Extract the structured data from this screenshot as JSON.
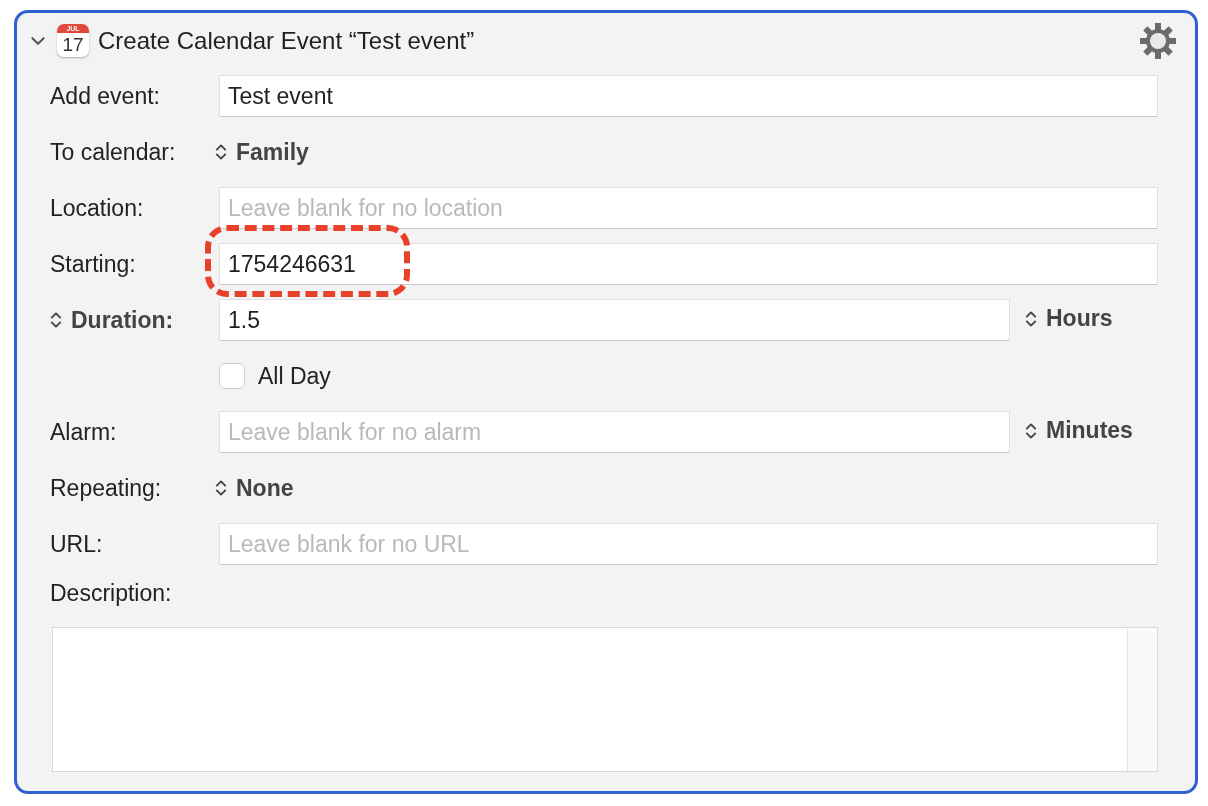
{
  "action": {
    "title": "Create Calendar Event “Test event”",
    "expanded": true,
    "icon": {
      "month": "JUL",
      "day": "17"
    }
  },
  "rows": [
    {
      "kind": "field",
      "label": "Add event:",
      "value": "Test event"
    },
    {
      "kind": "popup",
      "label": "To calendar:",
      "choice": "Family"
    },
    {
      "kind": "field",
      "label": "Location:",
      "placeholder": "Leave blank for no location"
    },
    {
      "kind": "field",
      "label": "Starting:",
      "value": "1754246631",
      "highlighted": true
    },
    {
      "kind": "popup_field",
      "label": "Duration:",
      "value": "1.5",
      "unit": "Hours"
    },
    {
      "kind": "checkbox",
      "label": "All Day",
      "checked": false
    },
    {
      "kind": "field_unit",
      "label": "Alarm:",
      "placeholder": "Leave blank for no alarm",
      "unit": "Minutes"
    },
    {
      "kind": "popup",
      "label": "Repeating:",
      "choice": "None"
    },
    {
      "kind": "field",
      "label": "URL:",
      "placeholder": "Leave blank for no URL"
    }
  ],
  "description": {
    "label": "Description:"
  }
}
